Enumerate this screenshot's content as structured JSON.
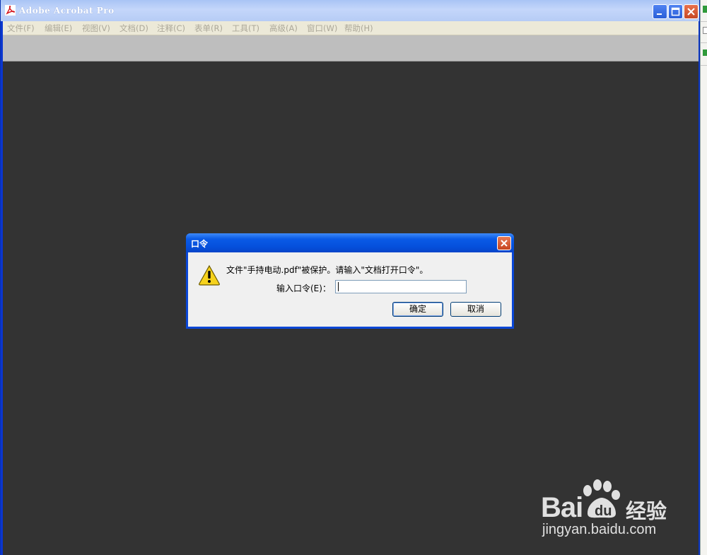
{
  "window": {
    "title": "Adobe Acrobat Pro"
  },
  "menu": [
    {
      "label": "文件(F)"
    },
    {
      "label": "编辑(E)"
    },
    {
      "label": "视图(V)"
    },
    {
      "label": "文档(D)"
    },
    {
      "label": "注释(C)"
    },
    {
      "label": "表单(R)"
    },
    {
      "label": "工具(T)"
    },
    {
      "label": "高级(A)"
    },
    {
      "label": "窗口(W)"
    },
    {
      "label": "帮助(H)"
    }
  ],
  "dialog": {
    "title": "口令",
    "message": "文件\"手持电动.pdf\"被保护。请输入\"文档打开口令\"。",
    "password_label": "输入口令(E)：",
    "password_value": "",
    "ok_label": "确定",
    "cancel_label": "取消"
  },
  "watermark": {
    "brand": "Bai",
    "brand_suffix": "du",
    "product": "经验",
    "url": "jingyan.baidu.com"
  },
  "colors": {
    "workspace": "#333333",
    "titlebar_blue": "#0a47d6",
    "close_red": "#d5582f"
  }
}
